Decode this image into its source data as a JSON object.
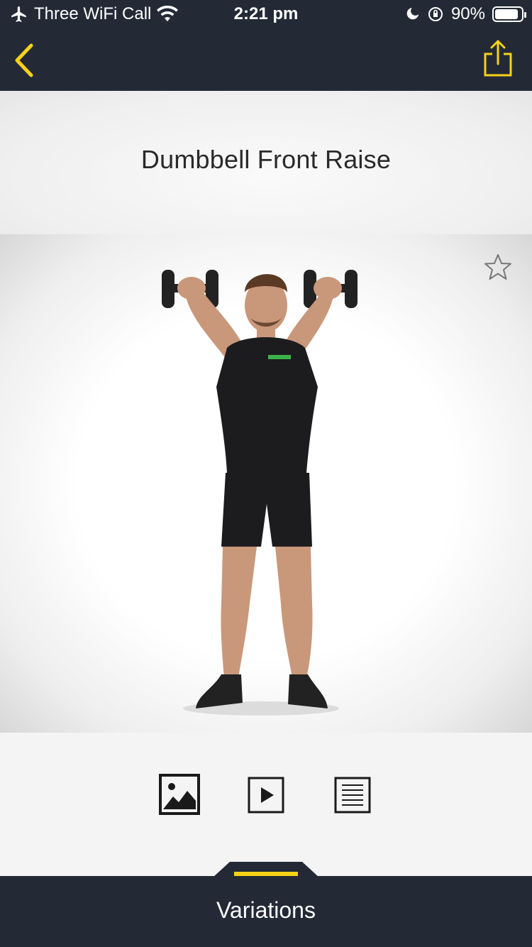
{
  "status_bar": {
    "carrier": "Three WiFi Call",
    "time": "2:21 pm",
    "battery": "90%",
    "battery_level": 0.9
  },
  "nav": {
    "back_icon": "chevron-left-icon",
    "share_icon": "share-icon",
    "accent_color": "#f7d117"
  },
  "exercise": {
    "title": "Dumbbell Front Raise",
    "favorite_icon": "star-outline-icon"
  },
  "view_modes": [
    {
      "name": "image-view",
      "icon": "image-icon"
    },
    {
      "name": "video-view",
      "icon": "play-icon"
    },
    {
      "name": "text-view",
      "icon": "list-icon"
    }
  ],
  "bottom": {
    "label": "Variations"
  },
  "colors": {
    "bar": "#232a36",
    "accent": "#f7d117"
  }
}
